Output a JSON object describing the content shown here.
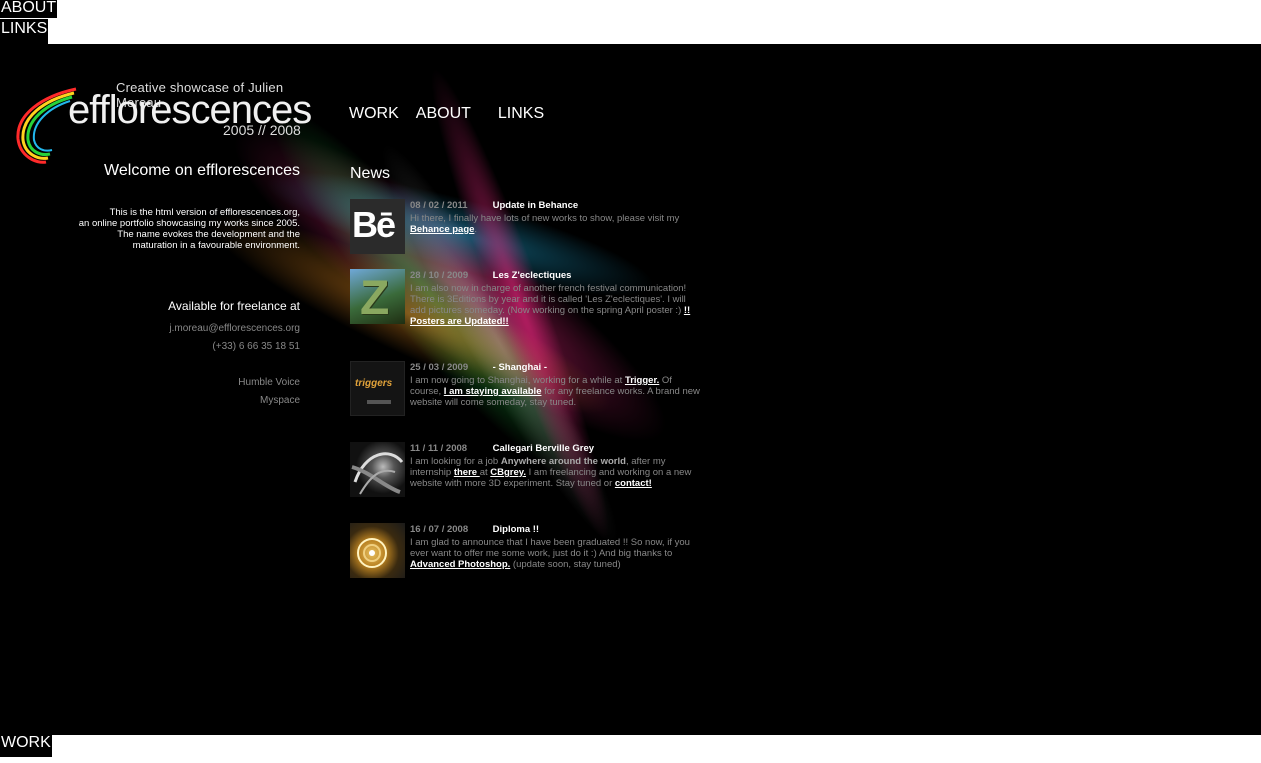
{
  "floaters": {
    "about": "ABOUT",
    "links": "LINKS",
    "work": "WORK"
  },
  "logo": {
    "tagline": "Creative showcase of Julien Moreau",
    "brand": "efflorescences",
    "years": "2005 // 2008"
  },
  "nav": {
    "work": "WORK",
    "about": "ABOUT",
    "links": "LINKS"
  },
  "left": {
    "welcome": "Welcome on efflorescences",
    "intro": [
      "This is the html version of efflorescences.org,",
      "an online portfolio showcasing my works since 2005.",
      "The name evokes the development and the",
      "maturation in a favourable environment."
    ],
    "freelance_title": "Available for freelance at",
    "email": "j.moreau@efflorescences.org",
    "phone": "(+33) 6 66 35 18 51",
    "links": [
      "Humble Voice",
      "Myspace"
    ]
  },
  "news": {
    "title": "News",
    "items": [
      {
        "date": "08 / 02 / 2011",
        "headline": "Update in Behance",
        "text_pre": "Hi there, I finally have lots of new works to show, please visit my ",
        "link1": "Behance page",
        "text_post": "."
      },
      {
        "date": "28 / 10 / 2009",
        "headline": "Les Z'eclectiques",
        "text_pre": "I am also now in charge of another french festival communication! There is 3Editions by year and it is called 'Les Z'eclectiques'. I will add pictures someday. (Now working on the spring April poster :) ",
        "link1": "!! Posters are Updated!!",
        "text_post": ""
      },
      {
        "date": "25 / 03 / 2009",
        "headline": "- Shanghai -",
        "text_pre": "I am now going to Shanghai, working for a while at ",
        "link1": "Trigger.",
        "text_mid": " Of course, ",
        "link2": "I am staying available",
        "text_post": " for any freelance works. A brand new website will come someday, stay tuned."
      },
      {
        "date": "11 / 11 / 2008",
        "headline": "Callegari Berville Grey",
        "text_pre": "I am looking for a job ",
        "bold1": "Anywhere around the world",
        "text_mid": ", after my internship ",
        "link1": "there ",
        "text_mid2": "at ",
        "link2": "CBgrey.",
        "text_mid3": " I am freelancing and working on a new website with more 3D experiment. Stay tuned or ",
        "link3": "contact!",
        "text_post": ""
      },
      {
        "date": "16 / 07 / 2008",
        "headline": "Diploma !!",
        "text_pre": "I am glad to announce that I have been graduated !! So now, if you ever want to offer me some work, just do it :) And big thanks to ",
        "link1": "Advanced Photoshop.",
        "text_post": " (update soon, stay tuned)"
      }
    ],
    "thumbs": {
      "behance_label": "Bē",
      "trigger_label": "triggers"
    }
  },
  "colors": {
    "background": "#000000",
    "muted_text": "#888888",
    "text": "#ffffff"
  }
}
